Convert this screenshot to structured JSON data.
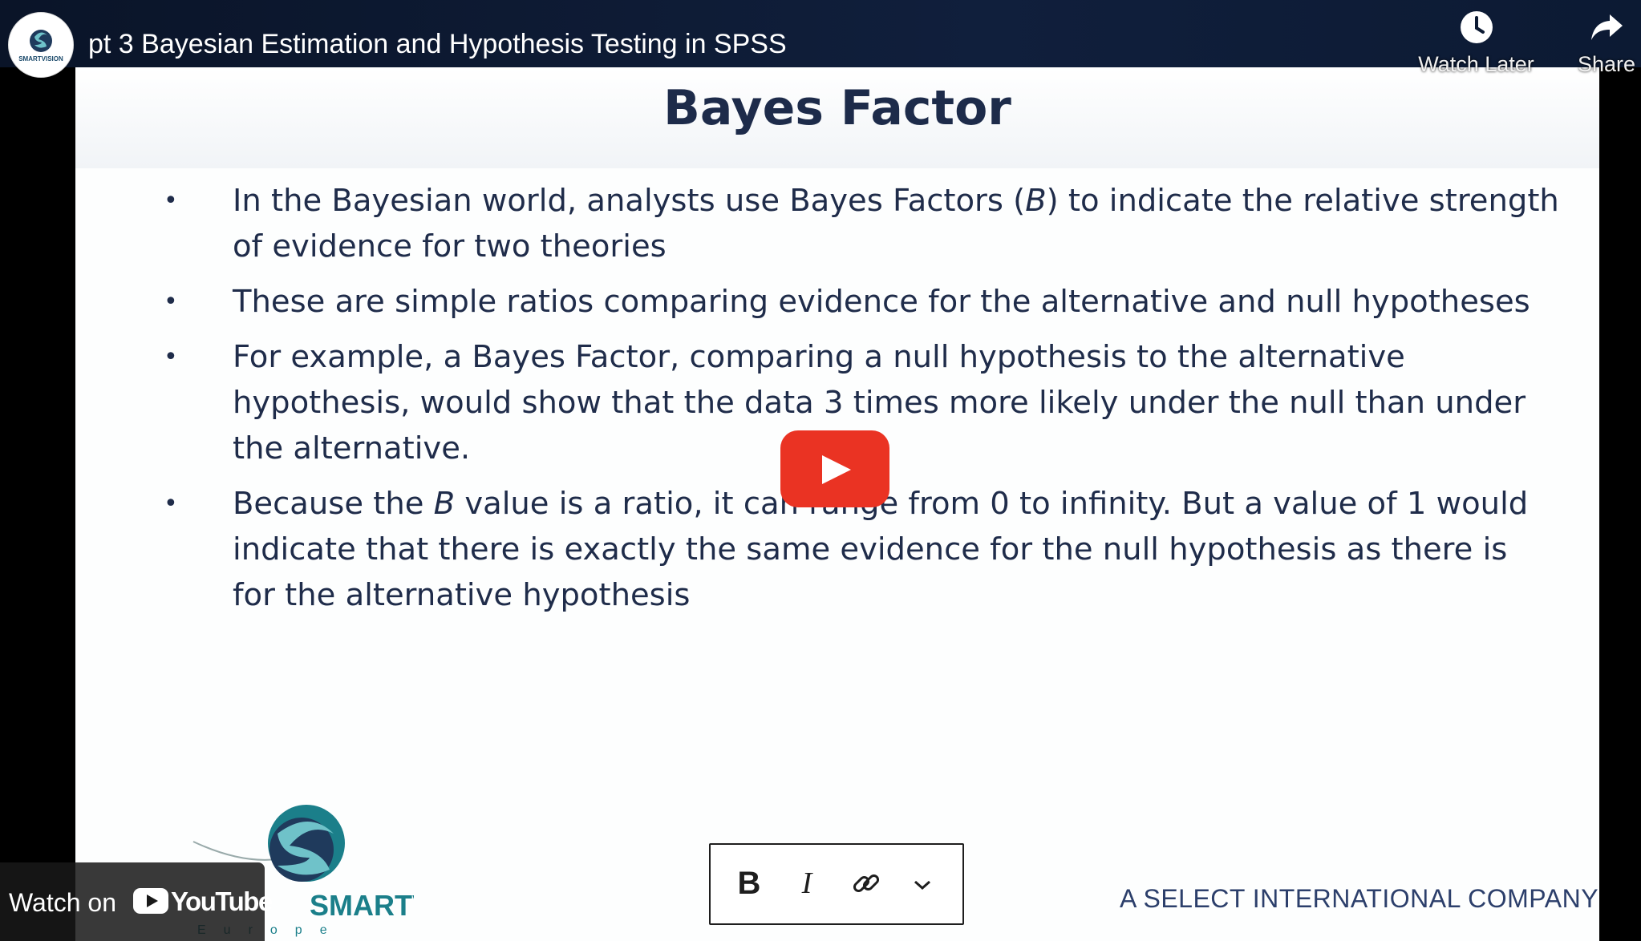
{
  "player": {
    "title": "pt 3 Bayesian Estimation and Hypothesis Testing in SPSS",
    "watch_later_label": "Watch Later",
    "share_label": "Share",
    "watch_on_label": "Watch on",
    "youtube_label": "YouTube",
    "play_icon": "play-icon"
  },
  "slide": {
    "title": "Bayes Factor",
    "bullets": [
      {
        "before": "In the Bayesian world, analysts use Bayes Factors (",
        "italic": "B",
        "after": ") to indicate the relative strength of evidence for two theories"
      },
      {
        "before": "These are simple ratios comparing evidence for the alternative and null hypotheses",
        "italic": "",
        "after": ""
      },
      {
        "before": "For example, a Bayes Factor, comparing a null hypothesis to the alternative hypothesis, would show that the data 3 times more likely under the null than under the alternative.",
        "italic": "",
        "after": ""
      },
      {
        "before": "Because the ",
        "italic": "B",
        "after": " value is a ratio, it can range from 0 to infinity. But a value of 1 would indicate that there is exactly the same evidence for the null hypothesis as there is for the alternative hypothesis"
      }
    ],
    "logo_text": "SMARTVISION",
    "logo_subtext": "Europe",
    "company": "A SELECT INTERNATIONAL COMPANY"
  },
  "format_toolbar": {
    "bold": "B",
    "italic": "I",
    "icons": [
      "bold-icon",
      "italic-icon",
      "link-icon",
      "chevron-down-icon"
    ]
  },
  "colors": {
    "topbar": "#0c1a33",
    "title": "#1d2b4a",
    "play": "#ea3323"
  }
}
